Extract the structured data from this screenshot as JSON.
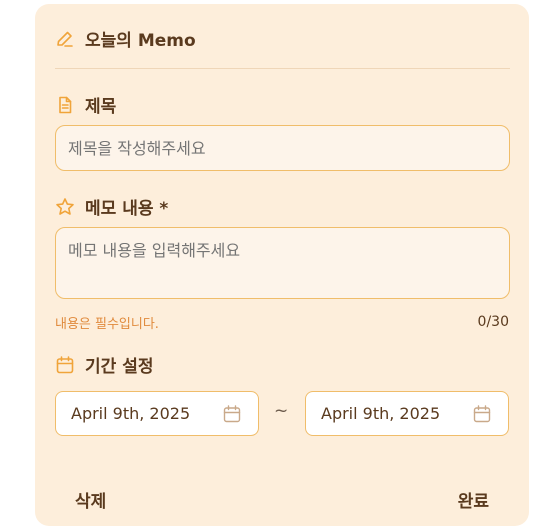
{
  "header": {
    "title": "오늘의 Memo",
    "icon": "pencil-icon"
  },
  "title_section": {
    "label": "제목",
    "icon": "document-icon",
    "placeholder": "제목을 작성해주세요",
    "value": ""
  },
  "content_section": {
    "label": "메모 내용 *",
    "icon": "star-icon",
    "placeholder": "메모 내용을 입력해주세요",
    "value": "",
    "error": "내용은 필수입니다.",
    "counter": "0/30"
  },
  "period_section": {
    "label": "기간 설정",
    "icon": "calendar-icon",
    "start_date": "April 9th, 2025",
    "end_date": "April 9th, 2025",
    "separator": "~"
  },
  "footer": {
    "delete_label": "삭제",
    "done_label": "완료"
  },
  "colors": {
    "card_bg": "#fdeedb",
    "accent": "#f0a43a",
    "text": "#5a3a1e",
    "error": "#e08a3c"
  }
}
